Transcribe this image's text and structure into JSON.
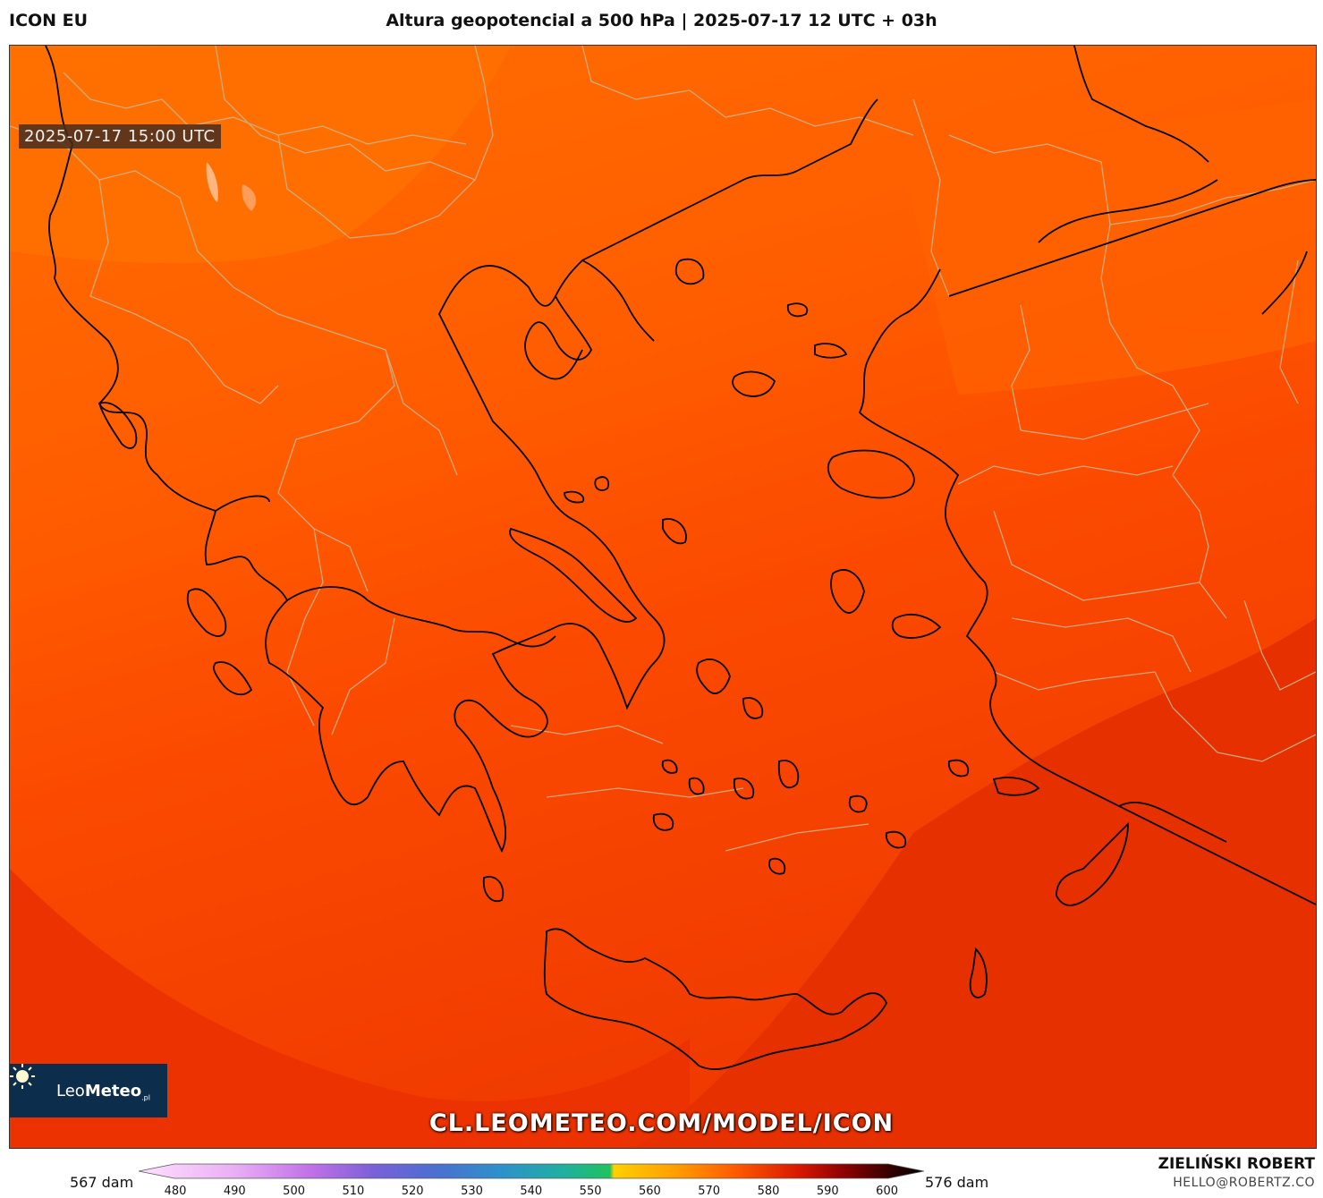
{
  "header": {
    "model": "ICON EU",
    "title": "Altura geopotencial a 500 hPa | 2025-07-17 12 UTC + 03h"
  },
  "map": {
    "valid_time": "2025-07-17 15:00 UTC",
    "region": "Greece / Aegean Sea",
    "field_colors": {
      "north": "#ff6a00",
      "middle": "#ff5500",
      "south": "#f24000",
      "southeast": "#e82e00",
      "coast_lines": "#000000",
      "borders": "#c8b08a"
    },
    "watermark_url": "CL.LEOMETEO.COM/MODEL/ICON"
  },
  "logo": {
    "brand_light": "Leo",
    "brand_bold": "Meteo",
    "suffix": ".pl"
  },
  "legend": {
    "min_label": "567 dam",
    "max_label": "576 dam",
    "ticks": [
      "480",
      "490",
      "500",
      "510",
      "520",
      "530",
      "540",
      "550",
      "560",
      "570",
      "580",
      "590",
      "600"
    ],
    "stops": [
      "#ffd6ff",
      "#e7a6f0",
      "#c472e6",
      "#8a5ad8",
      "#4a6ad0",
      "#2f8ad0",
      "#1fa7b0",
      "#22c277",
      "#ffd700",
      "#ff9d00",
      "#ff5a00",
      "#e32000",
      "#a00000",
      "#500000",
      "#000000"
    ]
  },
  "footer": {
    "author": "ZIELIŃSKI ROBERT",
    "email": "HELLO@ROBERTZ.CO"
  }
}
